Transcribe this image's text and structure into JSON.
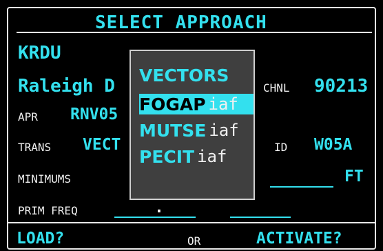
{
  "title": "SELECT APPROACH",
  "airport": "KRDU",
  "airport_name": "Raleigh D",
  "chnl": {
    "label": "CHNL",
    "value": "90213"
  },
  "apr": {
    "label": "APR",
    "value": "RNV05"
  },
  "trans": {
    "label": "TRANS",
    "value": "VECT"
  },
  "id": {
    "label": "ID",
    "value": "W05A"
  },
  "minimums": {
    "label": "MINIMUMS",
    "unit": "FT"
  },
  "prim_freq": {
    "label": "PRIM FREQ",
    "value": "."
  },
  "footer": {
    "load": "LOAD?",
    "or": "OR",
    "activate": "ACTIVATE?"
  },
  "popup": {
    "items": [
      {
        "name": "VECTORS",
        "tag": ""
      },
      {
        "name": "FOGAP",
        "tag": "iaf"
      },
      {
        "name": "MUTSE",
        "tag": "iaf"
      },
      {
        "name": "PECIT",
        "tag": "iaf"
      }
    ],
    "selected_index": 1
  },
  "colors": {
    "cyan": "#33e0ee",
    "white": "#f0f0f0",
    "popup_bg": "#3f3f3f"
  }
}
